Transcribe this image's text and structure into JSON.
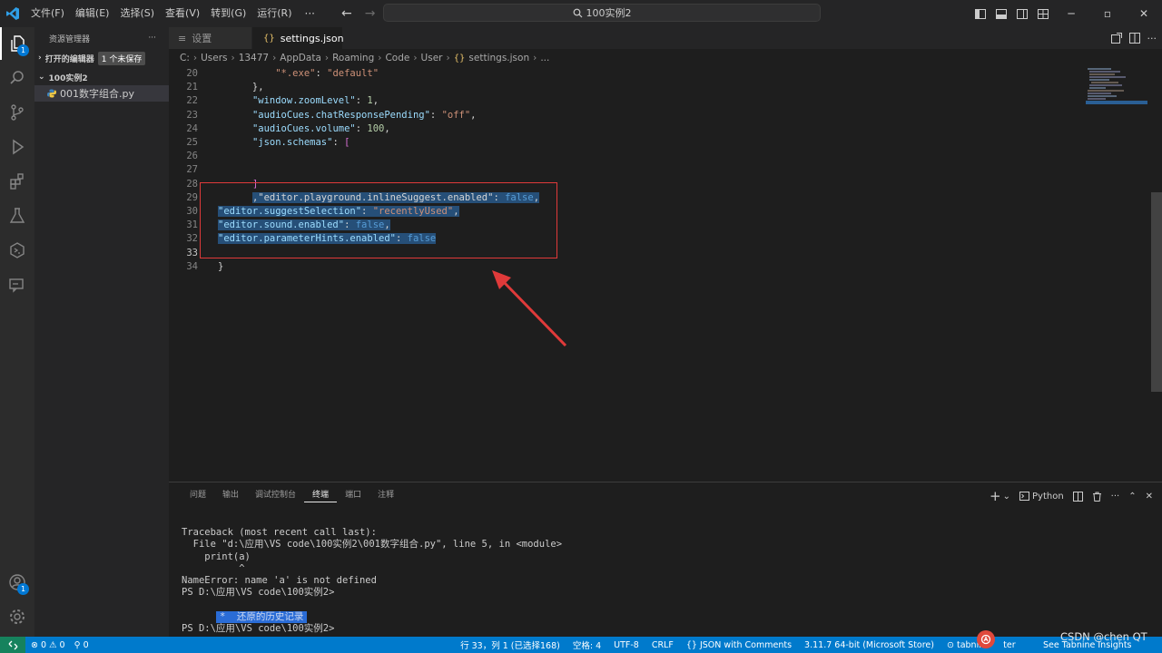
{
  "menu": [
    "文件(F)",
    "编辑(E)",
    "选择(S)",
    "查看(V)",
    "转到(G)",
    "运行(R)"
  ],
  "menu_more": "···",
  "command_center": "100实例2",
  "explorer": {
    "title": "资源管理器",
    "more": "···",
    "open_editors": "打开的编辑器",
    "unsaved_badge": "1 个未保存",
    "folder": "100实例2",
    "file": "001数字组合.py"
  },
  "tabs": [
    {
      "label": "设置"
    },
    {
      "label": "settings.json"
    }
  ],
  "breadcrumb": [
    "C:",
    "Users",
    "13477",
    "AppData",
    "Roaming",
    "Code",
    "User",
    "settings.json",
    "..."
  ],
  "code_lines": [
    {
      "n": "20",
      "parts": [
        [
          "p",
          "          "
        ],
        [
          "s",
          "\"*.exe\""
        ],
        [
          "p",
          ": "
        ],
        [
          "s",
          "\"default\""
        ]
      ]
    },
    {
      "n": "21",
      "parts": [
        [
          "p",
          "      },"
        ]
      ]
    },
    {
      "n": "22",
      "parts": [
        [
          "p",
          "      "
        ],
        [
          "k",
          "\"window.zoomLevel\""
        ],
        [
          "p",
          ": "
        ],
        [
          "n",
          "1"
        ],
        [
          "p",
          ","
        ]
      ]
    },
    {
      "n": "23",
      "parts": [
        [
          "p",
          "      "
        ],
        [
          "k",
          "\"audioCues.chatResponsePending\""
        ],
        [
          "p",
          ": "
        ],
        [
          "s",
          "\"off\""
        ],
        [
          "p",
          ","
        ]
      ]
    },
    {
      "n": "24",
      "parts": [
        [
          "p",
          "      "
        ],
        [
          "k",
          "\"audioCues.volume\""
        ],
        [
          "p",
          ": "
        ],
        [
          "n",
          "100"
        ],
        [
          "p",
          ","
        ]
      ]
    },
    {
      "n": "25",
      "parts": [
        [
          "p",
          "      "
        ],
        [
          "k",
          "\"json.schemas\""
        ],
        [
          "p",
          ": "
        ],
        [
          "br",
          "["
        ]
      ]
    },
    {
      "n": "26",
      "parts": []
    },
    {
      "n": "27",
      "parts": []
    },
    {
      "n": "28",
      "parts": [
        [
          "p",
          "      "
        ],
        [
          "br",
          "]"
        ]
      ]
    },
    {
      "n": "29",
      "parts": [
        [
          "p",
          "      "
        ],
        [
          "selp",
          ",\"editor.playground.inlineSuggest.enabled\": "
        ],
        [
          "selb",
          "false"
        ],
        [
          "selp",
          ","
        ]
      ]
    },
    {
      "n": "30",
      "parts": [
        [
          "selk",
          "\"editor.suggestSelection\""
        ],
        [
          "selp",
          ": "
        ],
        [
          "sels",
          "\"recentlyUsed\""
        ],
        [
          "selp",
          ","
        ]
      ]
    },
    {
      "n": "31",
      "parts": [
        [
          "selk",
          "\"editor.sound.enabled\""
        ],
        [
          "selp",
          ": "
        ],
        [
          "selb",
          "false"
        ],
        [
          "selp",
          ","
        ]
      ]
    },
    {
      "n": "32",
      "parts": [
        [
          "selk",
          "\"editor.parameterHints.enabled\""
        ],
        [
          "selp",
          ": "
        ],
        [
          "selb",
          "false"
        ]
      ]
    },
    {
      "n": "33",
      "parts": []
    },
    {
      "n": "34",
      "parts": [
        [
          "p",
          "}"
        ]
      ]
    }
  ],
  "panel": {
    "tabs": [
      "问题",
      "输出",
      "调试控制台",
      "终端",
      "端口",
      "注释"
    ],
    "active_tab": "终端",
    "shell": "Python",
    "terminal": [
      "Traceback (most recent call last):",
      "  File \"d:\\应用\\VS code\\100实例2\\001数字组合.py\", line 5, in <module>",
      "    print(a)",
      "          ^",
      "NameError: name 'a' is not defined",
      "PS D:\\应用\\VS code\\100实例2>",
      "",
      "",
      "PS D:\\应用\\VS code\\100实例2>"
    ],
    "history_marker": "*",
    "history_label": "还原的历史记录"
  },
  "status": {
    "errors": "0",
    "warnings": "0",
    "ports": "0",
    "position": "行 33，列 1 (已选择168)",
    "spaces": "空格: 4",
    "encoding": "UTF-8",
    "eol": "CRLF",
    "language": "JSON with Comments",
    "interpreter": "3.11.7 64-bit (Microsoft Store)",
    "tabnine": "tabnine",
    "tabnine_suffix": "ter",
    "insights": "See Tabnine Insights"
  },
  "watermark": "CSDN @chen QT",
  "colors": {
    "accent": "#007acc",
    "annotation": "#e03a3a",
    "selection": "#264f78"
  }
}
